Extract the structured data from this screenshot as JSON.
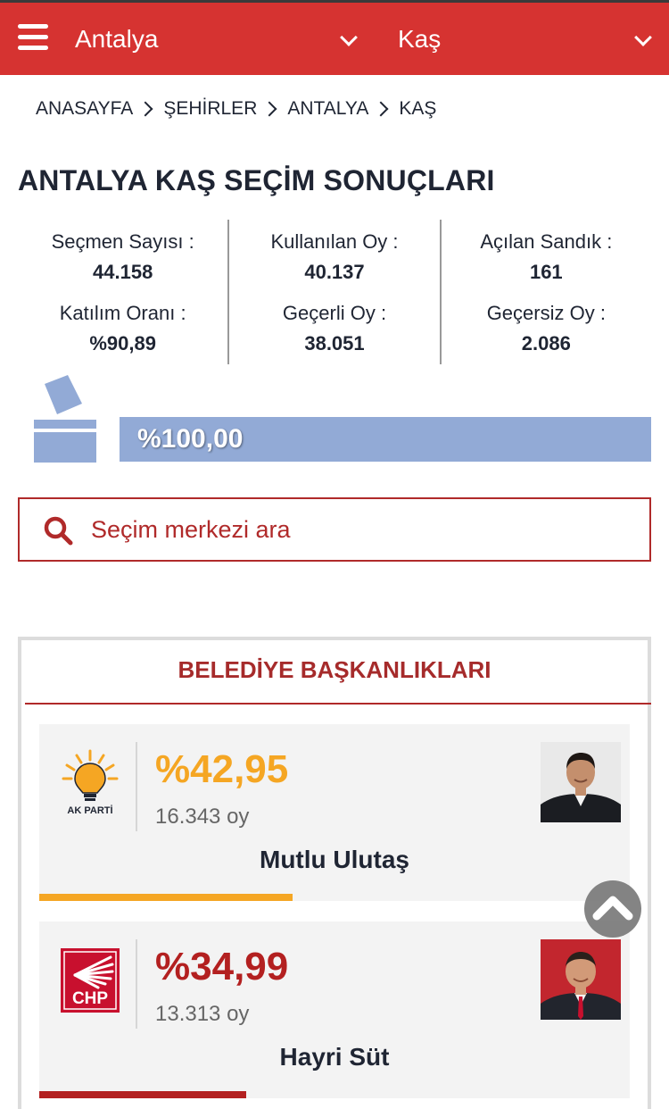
{
  "header": {
    "city": "Antalya",
    "district": "Kaş"
  },
  "breadcrumb": [
    "ANASAYFA",
    "ŞEHİRLER",
    "ANTALYA",
    "KAŞ"
  ],
  "page_title": "ANTALYA KAŞ SEÇİM SONUÇLARI",
  "stats": {
    "voters_label": "Seçmen Sayısı :",
    "voters_value": "44.158",
    "used_label": "Kullanılan Oy :",
    "used_value": "40.137",
    "boxes_label": "Açılan Sandık :",
    "boxes_value": "161",
    "turnout_label": "Katılım Oranı :",
    "turnout_value": "%90,89",
    "valid_label": "Geçerli Oy :",
    "valid_value": "38.051",
    "invalid_label": "Geçersiz Oy :",
    "invalid_value": "2.086"
  },
  "progress": {
    "text": "%100,00",
    "fraction": 1.0
  },
  "search": {
    "placeholder": "Seçim merkezi ara"
  },
  "results": {
    "title": "BELEDİYE BAŞKANLIKLARI",
    "candidates": [
      {
        "party": "AK PARTİ",
        "percent": "%42,95",
        "votes": "16.343 oy",
        "name": "Mutlu Ulutaş",
        "color": "#f5a623",
        "share": 0.4295
      },
      {
        "party": "CHP",
        "percent": "%34,99",
        "votes": "13.313 oy",
        "name": "Hayri Süt",
        "color": "#b32020",
        "share": 0.3499
      }
    ]
  },
  "colors": {
    "header": "#d63331",
    "accent": "#b02a2a",
    "progress": "#92aad6"
  }
}
